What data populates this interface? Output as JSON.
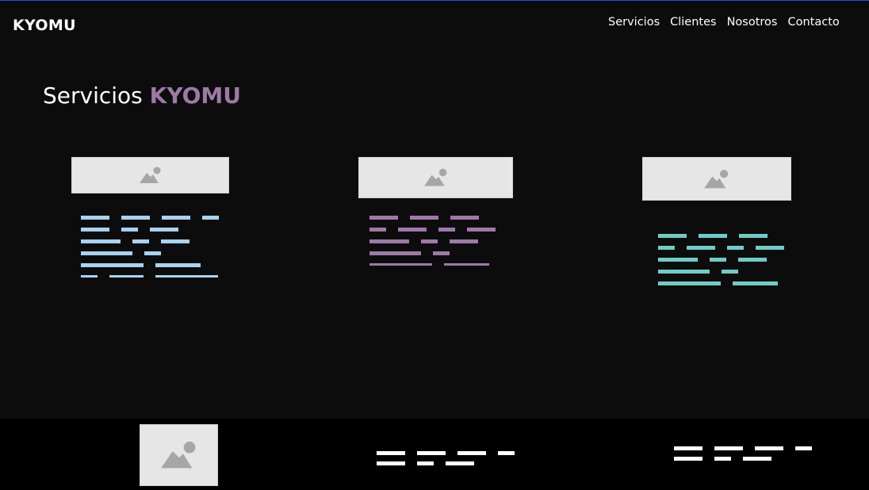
{
  "brand": {
    "logo_text": "KYOMU"
  },
  "nav": {
    "items": [
      "Servicios",
      "Clientes",
      "Nosotros",
      "Contacto"
    ]
  },
  "section": {
    "title_plain": "Servicios ",
    "title_accent": "KYOMU",
    "accent_color": "#9d7aa6"
  },
  "cards": [
    {
      "name": "service-card-1",
      "image_icon": "image-placeholder-icon",
      "text_color": "#a8d2f0"
    },
    {
      "name": "service-card-2",
      "image_icon": "image-placeholder-icon",
      "text_color": "#9d7aa6"
    },
    {
      "name": "service-card-3",
      "image_icon": "image-placeholder-icon",
      "text_color": "#6ecdc6"
    }
  ],
  "footer": {
    "image_icon": "image-placeholder-icon",
    "text_color": "#ffffff",
    "background": "#000000"
  },
  "colors": {
    "page_background": "#0c0c0c",
    "nav_text": "#ffffff",
    "top_border": "#2b4fd0",
    "placeholder_fill": "#e6e6e6",
    "placeholder_icon": "#a6a6a6"
  }
}
